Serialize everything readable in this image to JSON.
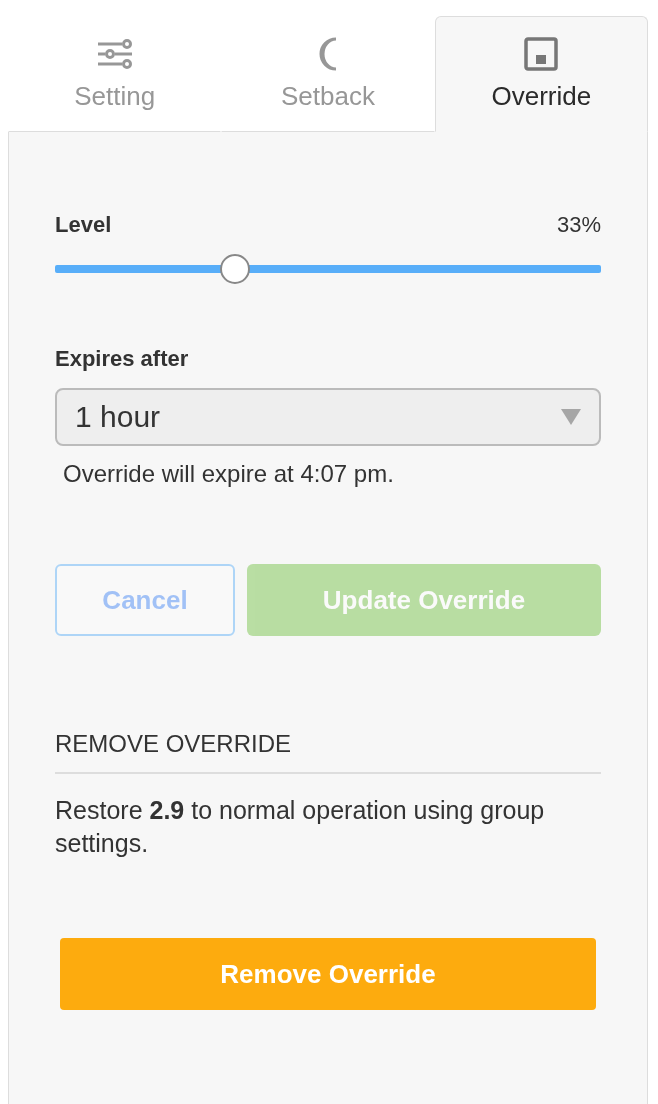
{
  "tabs": [
    {
      "label": "Setting",
      "kind": "sliders",
      "selected": false
    },
    {
      "label": "Setback",
      "kind": "moon",
      "selected": false
    },
    {
      "label": "Override",
      "kind": "switch",
      "selected": true
    }
  ],
  "level": {
    "label": "Level",
    "reading": "33%",
    "level": 0.33
  },
  "expires": {
    "label": "Expires after",
    "value": "1 hour",
    "note": "Override will expire at 4:07 pm."
  },
  "buttons": [
    {
      "label": "Cancel",
      "kind": "outline",
      "disabled": true
    },
    {
      "label": "Update Override",
      "kind": "primary",
      "disabled": true
    }
  ],
  "remove": {
    "heading": "REMOVE OVERRIDE",
    "text": "Restore **2.9** to normal operation using group settings.",
    "button": "Remove Override"
  }
}
